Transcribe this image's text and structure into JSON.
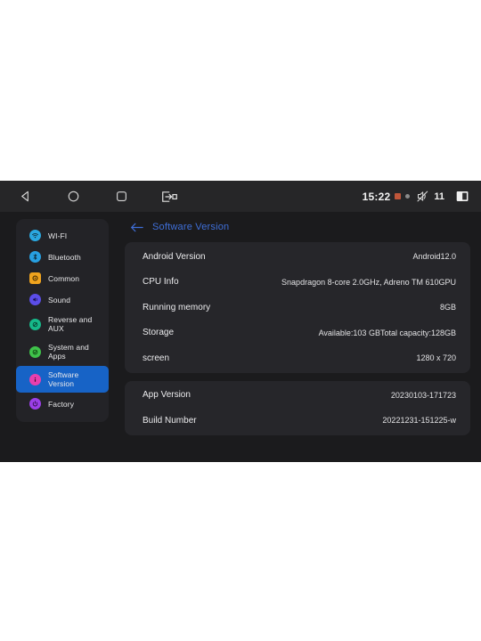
{
  "statusbar": {
    "nav": [
      {
        "name": "back",
        "label": "Back"
      },
      {
        "name": "home",
        "label": "Home"
      },
      {
        "name": "recents",
        "label": "Recent apps"
      },
      {
        "name": "screen-switch",
        "label": "Screen switch"
      }
    ],
    "clock": "15:22",
    "volume_level": "11",
    "mute_icon": "volume-mute-icon",
    "battery_icon": "battery-icon",
    "indicator_icons": [
      "recording-indicator-icon",
      "location-indicator-icon"
    ]
  },
  "sidebar": {
    "items": [
      {
        "label": "WI-FI",
        "icon": "wifi-icon",
        "color": "#2aa8e0",
        "shape": "circle",
        "active": false
      },
      {
        "label": "Bluetooth",
        "icon": "bluetooth-icon",
        "color": "#27a0e2",
        "shape": "circle",
        "active": false
      },
      {
        "label": "Common",
        "icon": "gear-icon",
        "color": "#f0a41e",
        "shape": "square",
        "active": false
      },
      {
        "label": "Sound",
        "icon": "speaker-icon",
        "color": "#5b4de8",
        "shape": "circle",
        "active": false
      },
      {
        "label": "Reverse and AUX",
        "icon": "reverse-camera-icon",
        "color": "#16b98a",
        "shape": "circle",
        "active": false
      },
      {
        "label": "System and Apps",
        "icon": "apps-icon",
        "color": "#3fc24a",
        "shape": "circle",
        "active": false
      },
      {
        "label": "Software Version",
        "icon": "info-icon",
        "color": "#e83fae",
        "shape": "circle",
        "active": true
      },
      {
        "label": "Factory",
        "icon": "power-icon",
        "color": "#9b3fe8",
        "shape": "circle",
        "active": false
      }
    ]
  },
  "main": {
    "back_icon": "arrow-left-icon",
    "title": "Software Version",
    "cards": [
      {
        "rows": [
          {
            "label": "Android Version",
            "value": "Android12.0"
          },
          {
            "label": "CPU Info",
            "value": "Snapdragon 8-core 2.0GHz, Adreno TM 610GPU"
          },
          {
            "label": "Running memory",
            "value": "8GB"
          },
          {
            "label": "Storage",
            "value": "Available:103 GBTotal capacity:128GB"
          },
          {
            "label": "screen",
            "value": "1280 x 720"
          }
        ]
      },
      {
        "rows": [
          {
            "label": "App Version",
            "value": "20230103-171723"
          },
          {
            "label": "Build Number",
            "value": "20221231-151225-w"
          }
        ]
      }
    ]
  },
  "colors": {
    "accent_blue": "#3f6fd8",
    "selection_blue": "#1763c6",
    "panel_bg": "#26262a",
    "sidebar_bg": "#232327",
    "screen_bg": "#1b1b1d",
    "statusbar_bg": "#262628"
  }
}
